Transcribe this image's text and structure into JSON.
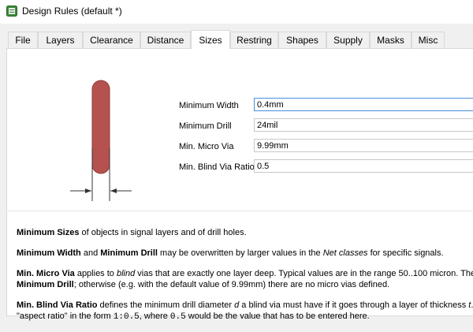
{
  "window": {
    "title": "Design Rules (default *)"
  },
  "tabs": [
    {
      "label": "File"
    },
    {
      "label": "Layers"
    },
    {
      "label": "Clearance"
    },
    {
      "label": "Distance"
    },
    {
      "label": "Sizes"
    },
    {
      "label": "Restring"
    },
    {
      "label": "Shapes"
    },
    {
      "label": "Supply"
    },
    {
      "label": "Masks"
    },
    {
      "label": "Misc"
    }
  ],
  "active_tab": "Sizes",
  "fields": {
    "min_width": {
      "label": "Minimum Width",
      "value": "0.4mm"
    },
    "min_drill": {
      "label": "Minimum Drill",
      "value": "24mil"
    },
    "min_micro_via": {
      "label": "Min. Micro Via",
      "value": "9.99mm"
    },
    "min_blind_via_ratio": {
      "label": "Min. Blind Via Ratio",
      "value": "0.5"
    }
  },
  "help": {
    "p1_b1": "Minimum Sizes",
    "p1_t1": " of objects in signal layers and of drill holes.",
    "p2_b1": "Minimum Width",
    "p2_t1": " and ",
    "p2_b2": "Minimum Drill",
    "p2_t2": " may be overwritten by larger values in the ",
    "p2_i1": "Net classes",
    "p2_t3": " for specific signals.",
    "p3_b1": "Min. Micro Via",
    "p3_t1": " applies to ",
    "p3_i1": "blind",
    "p3_t2": " vias that are exactly one layer deep. Typical values are in the range 50..100 micron. The",
    "p3_b2": "Minimum Drill",
    "p3_t3": "; otherwise (e.g. with the default value of 9.99mm) there are no micro vias defined.",
    "p4_b1": "Min. Blind Via Ratio",
    "p4_t1": " defines the minimum drill diameter ",
    "p4_i1": "d",
    "p4_t2": " a blind via must have if it goes through a layer of thickness ",
    "p4_i2": "t",
    "p4_t3": ". I",
    "p4_t4": "\"aspect ratio\" in the form ",
    "p4_m1": "1:0.5",
    "p4_t5": ", where ",
    "p4_m2": "0.5",
    "p4_t6": " would be the value that has to be entered here."
  },
  "colors": {
    "trace": "#b5524f",
    "trace_outline": "#8f3c3a",
    "focus_border": "#4a8ed6"
  },
  "icons": {
    "app": "eagle-app-icon"
  }
}
